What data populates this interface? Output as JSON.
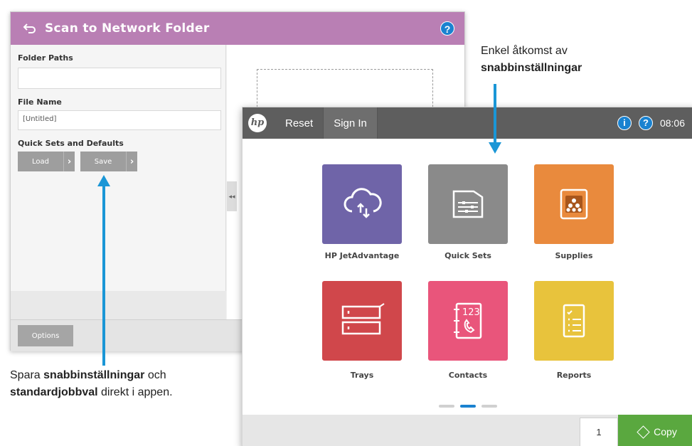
{
  "scan_window": {
    "title": "Scan to Network Folder",
    "help": "?",
    "folder_paths_label": "Folder Paths",
    "folder_paths_value": "",
    "file_name_label": "File Name",
    "file_name_value": "[Untitled]",
    "quick_sets_label": "Quick Sets and Defaults",
    "load_label": "Load",
    "save_label": "Save",
    "options_label": "Options"
  },
  "home_window": {
    "logo": "hp",
    "reset_label": "Reset",
    "signin_label": "Sign In",
    "info": "i",
    "help": "?",
    "time": "08:06",
    "tiles": [
      {
        "label": "HP JetAdvantage",
        "color": "#6f64a8",
        "icon": "cloud-sync-icon"
      },
      {
        "label": "Quick Sets",
        "color": "#8a8a8a",
        "icon": "quick-sets-folder-icon"
      },
      {
        "label": "Supplies",
        "color": "#e98a3d",
        "icon": "toner-supplies-icon"
      },
      {
        "label": "Trays",
        "color": "#d0474b",
        "icon": "paper-trays-icon"
      },
      {
        "label": "Contacts",
        "color": "#e9557b",
        "icon": "contacts-book-icon"
      },
      {
        "label": "Reports",
        "color": "#e8c33c",
        "icon": "reports-list-icon"
      }
    ],
    "contacts_number": "123",
    "copies": "1",
    "copy_label": "Copy",
    "active_page": 2,
    "accent_color": "#1a82d0",
    "copy_color": "#5aa83f"
  },
  "annotations": {
    "top_line1": "Enkel åtkomst av",
    "top_line2_bold": "snabbinställningar",
    "bottom_line1_a": "Spara ",
    "bottom_line1_bold": "snabbinställningar",
    "bottom_line1_b": " och",
    "bottom_line2_bold": "standardjobbval",
    "bottom_line2_b": " direkt i appen."
  }
}
